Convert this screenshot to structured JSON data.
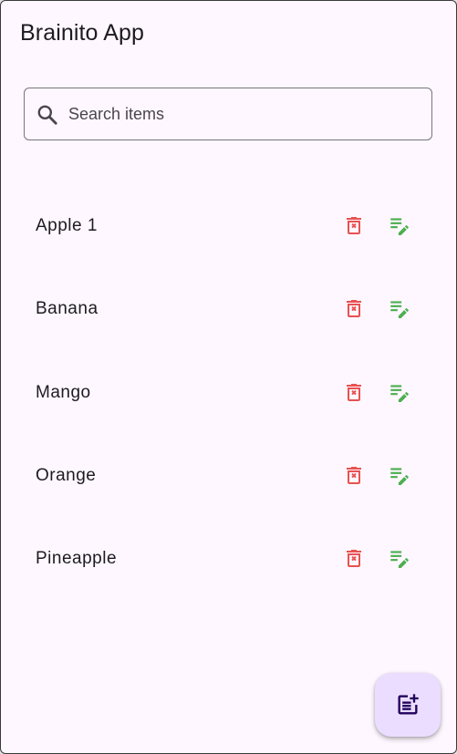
{
  "app": {
    "title": "Brainito App"
  },
  "search": {
    "placeholder": "Search items",
    "value": "",
    "icon": "search-icon"
  },
  "items": [
    {
      "label": "Apple 1"
    },
    {
      "label": "Banana"
    },
    {
      "label": "Mango"
    },
    {
      "label": "Orange"
    },
    {
      "label": "Pineapple"
    }
  ],
  "actions": {
    "delete_icon": "delete-forever-icon",
    "edit_icon": "edit-note-icon"
  },
  "fab": {
    "icon": "post-add-icon"
  },
  "colors": {
    "background": "#fef7ff",
    "delete": "#e85252",
    "edit": "#4caf50",
    "fab_bg": "#eaddff",
    "outline": "#79747e"
  }
}
